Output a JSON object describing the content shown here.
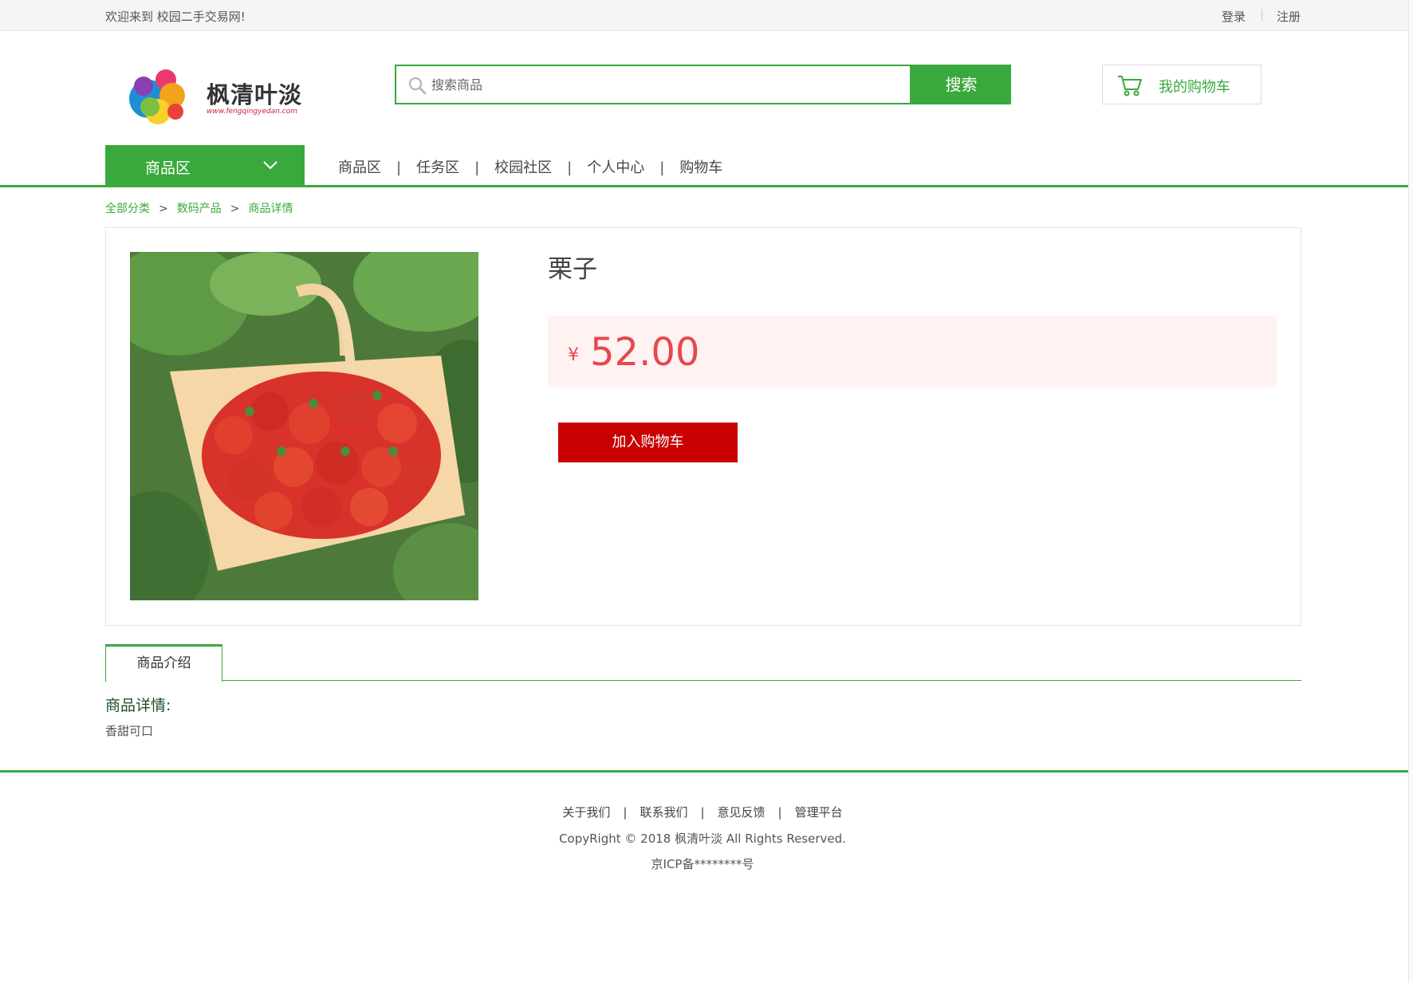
{
  "topbar": {
    "welcome": "欢迎来到 校园二手交易网!",
    "login": "登录",
    "separator": "|",
    "register": "注册"
  },
  "header": {
    "logo_name": "枫清叶淡",
    "logo_url": "www.fengqingyedan.com",
    "search_placeholder": "搜索商品",
    "search_button": "搜索",
    "cart_label": "我的购物车"
  },
  "nav": {
    "category_button": "商品区",
    "items": [
      "商品区",
      "任务区",
      "校园社区",
      "个人中心",
      "购物车"
    ],
    "separator": "|"
  },
  "breadcrumb": {
    "items": [
      "全部分类",
      "数码产品",
      "商品详情"
    ],
    "arrow": ">"
  },
  "product": {
    "title": "栗子",
    "currency": "¥",
    "price": "52.00",
    "add_to_cart": "加入购物车"
  },
  "tabs": {
    "active": "商品介绍"
  },
  "detail": {
    "heading": "商品详情:",
    "body": "香甜可口"
  },
  "footer": {
    "links": [
      "关于我们",
      "联系我们",
      "意见反馈",
      "管理平台"
    ],
    "separator": "|",
    "copyright": "CopyRight © 2018 枫清叶淡 All Rights Reserved.",
    "icp": "京ICP备********号"
  },
  "colors": {
    "brand_green": "#3aa93d",
    "price_red": "#e5484d",
    "cart_button_red": "#c70000",
    "price_bg": "#fff3f2"
  }
}
